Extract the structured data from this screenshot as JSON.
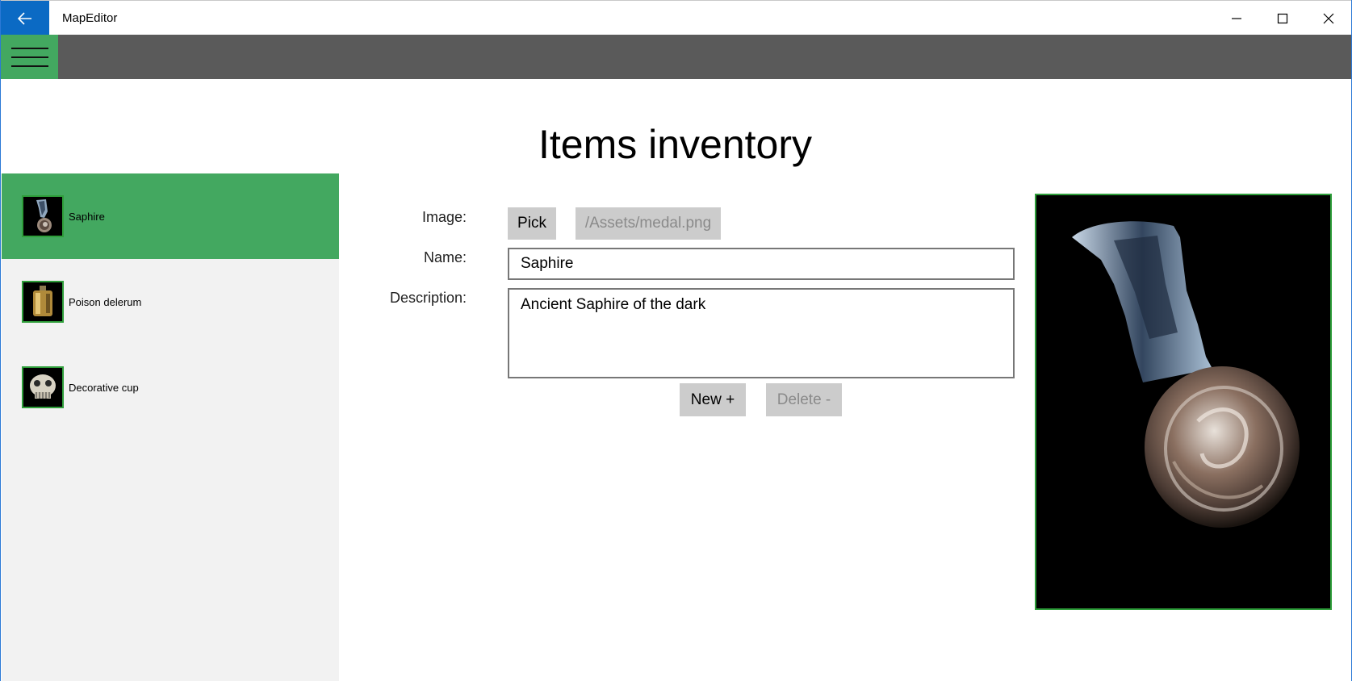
{
  "window": {
    "title": "MapEditor"
  },
  "titlebar": {
    "back_icon": "arrow-left-icon",
    "minimize_icon": "minimize-icon",
    "maximize_icon": "maximize-icon",
    "close_icon": "close-icon"
  },
  "cmdbar": {
    "menu_icon": "hamburger-icon"
  },
  "page": {
    "title": "Items inventory"
  },
  "items": [
    {
      "label": "Saphire",
      "icon": "medal-icon",
      "selected": true
    },
    {
      "label": "Poison delerum",
      "icon": "flask-icon",
      "selected": false
    },
    {
      "label": "Decorative cup",
      "icon": "skull-cup-icon",
      "selected": false
    }
  ],
  "form": {
    "image_label": "Image:",
    "name_label": "Name:",
    "description_label": "Description:",
    "pick_button": "Pick",
    "image_path": "/Assets/medal.png",
    "name_value": "Saphire",
    "description_value": "Ancient Saphire of the dark",
    "new_button": "New +",
    "delete_button": "Delete -"
  },
  "preview": {
    "icon": "medal-icon"
  },
  "colors": {
    "accent_green": "#43a860",
    "titlebar_blue": "#0b6ac4",
    "cmdbar_gray": "#5a5a5a",
    "sidebar_bg": "#f2f2f2"
  }
}
